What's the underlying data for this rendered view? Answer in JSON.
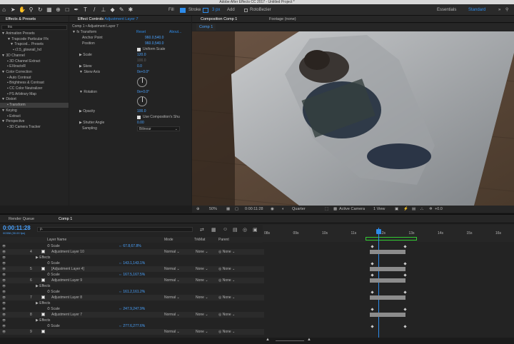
{
  "window": {
    "title": "Adobe After Effects CC 2017 - Untitled Project *"
  },
  "toolbar": {
    "fill_label": "Fill",
    "stroke_label": "Stroke",
    "stroke_px": "3 px",
    "add_label": "Add",
    "roto_label": "RotoBezier",
    "workspace_label": "Essentials",
    "standard_label": "Standard"
  },
  "effects_presets": {
    "tab": "Effects & Presets",
    "search": "tra",
    "items": [
      "Animation Presets",
      "Trapcode Particular Ffx",
      "Trapcod... Presets",
      "r2.5_glowrail_hd",
      "3D Channel",
      "3D Channel Extract",
      "EXtractoR",
      "Color Correction",
      "Auto Contrast",
      "Brightness & Contrast",
      "CC Color Neutralizer",
      "PS Arbitrary Map",
      "Distort",
      "Transform",
      "Keying",
      "Extract",
      "Perspective",
      "3D Camera Tracker"
    ]
  },
  "effect_controls": {
    "tab": "Effect Controls",
    "layer": "Adjustment Layer 7",
    "breadcrumb": "Comp 1 • Adjustment Layer 7",
    "effect": "Transform",
    "reset": "Reset",
    "about": "About...",
    "props": {
      "anchor_label": "Anchor Point",
      "anchor_val": "960.0,540.0",
      "position_label": "Position",
      "position_val": "960.0,540.0",
      "uniform_label": "Uniform Scale",
      "scale_label": "Scale",
      "scale_val": "120.0",
      "scale_val2": "100.0",
      "skew_label": "Skew",
      "skew_val": "0.0",
      "skew_axis_label": "Skew Axis",
      "skew_axis_val": "0x+0.0°",
      "rotation_label": "Rotation",
      "rotation_val": "0x+0.0°",
      "opacity_label": "Opacity",
      "opacity_val": "100.0",
      "use_comp_label": "Use Composition's Shu",
      "shutter_label": "Shutter Angle",
      "shutter_val": "0.00",
      "sampling_label": "Sampling",
      "sampling_val": "Bilinear"
    }
  },
  "composition": {
    "tab": "Composition Comp 1",
    "footage_tab": "Footage (none)",
    "sub_tab": "Comp 1",
    "zoom": "50%",
    "timecode": "0:00:11:28",
    "quality": "Quarter",
    "camera": "Active Camera",
    "view": "1 View",
    "offset": "+0.0"
  },
  "timeline": {
    "render_queue_tab": "Render Queue",
    "comp_tab": "Comp 1",
    "timecode": "0:00:11:28",
    "frame_info": "00358 (30.00 fps)",
    "search_placeholder": "ρ.",
    "headers": {
      "layer_name": "Layer Name",
      "mode": "Mode",
      "trkmat": "TrkMat",
      "parent": "Parent"
    },
    "ruler": [
      "08s",
      "09s",
      "10s",
      "11s",
      "12s",
      "13s",
      "14s",
      "15s",
      "16s"
    ],
    "rows": [
      {
        "num": "",
        "name": "Scale",
        "val": "67.8,67.8%",
        "type": "prop"
      },
      {
        "num": "4",
        "name": "Adjustment Layer 10",
        "type": "layer"
      },
      {
        "num": "",
        "name": "Effects",
        "type": "effects"
      },
      {
        "num": "",
        "name": "Scale",
        "val": "143.1,143.1%",
        "type": "prop"
      },
      {
        "num": "5",
        "name": "[Adjustment Layer 4]",
        "type": "layer"
      },
      {
        "num": "",
        "name": "Scale",
        "val": "167.5,167.5%",
        "type": "prop"
      },
      {
        "num": "6",
        "name": "Adjustment Layer 9",
        "type": "layer"
      },
      {
        "num": "",
        "name": "Effects",
        "type": "effects"
      },
      {
        "num": "",
        "name": "Scale",
        "val": "161.2,161.2%",
        "type": "prop"
      },
      {
        "num": "7",
        "name": "Adjustment Layer 8",
        "type": "layer"
      },
      {
        "num": "",
        "name": "Effects",
        "type": "effects"
      },
      {
        "num": "",
        "name": "Scale",
        "val": "247.9,247.9%",
        "type": "prop"
      },
      {
        "num": "8",
        "name": "Adjustment Layer 7",
        "type": "layer"
      },
      {
        "num": "",
        "name": "Effects",
        "type": "effects"
      },
      {
        "num": "",
        "name": "Scale",
        "val": "277.6,277.6%",
        "type": "prop"
      },
      {
        "num": "9",
        "name": "",
        "type": "layer"
      }
    ],
    "mode_val": "Normal",
    "none_val": "None"
  },
  "colors": {
    "accent": "#2d8ceb",
    "highlight": "#4aa3ff"
  }
}
